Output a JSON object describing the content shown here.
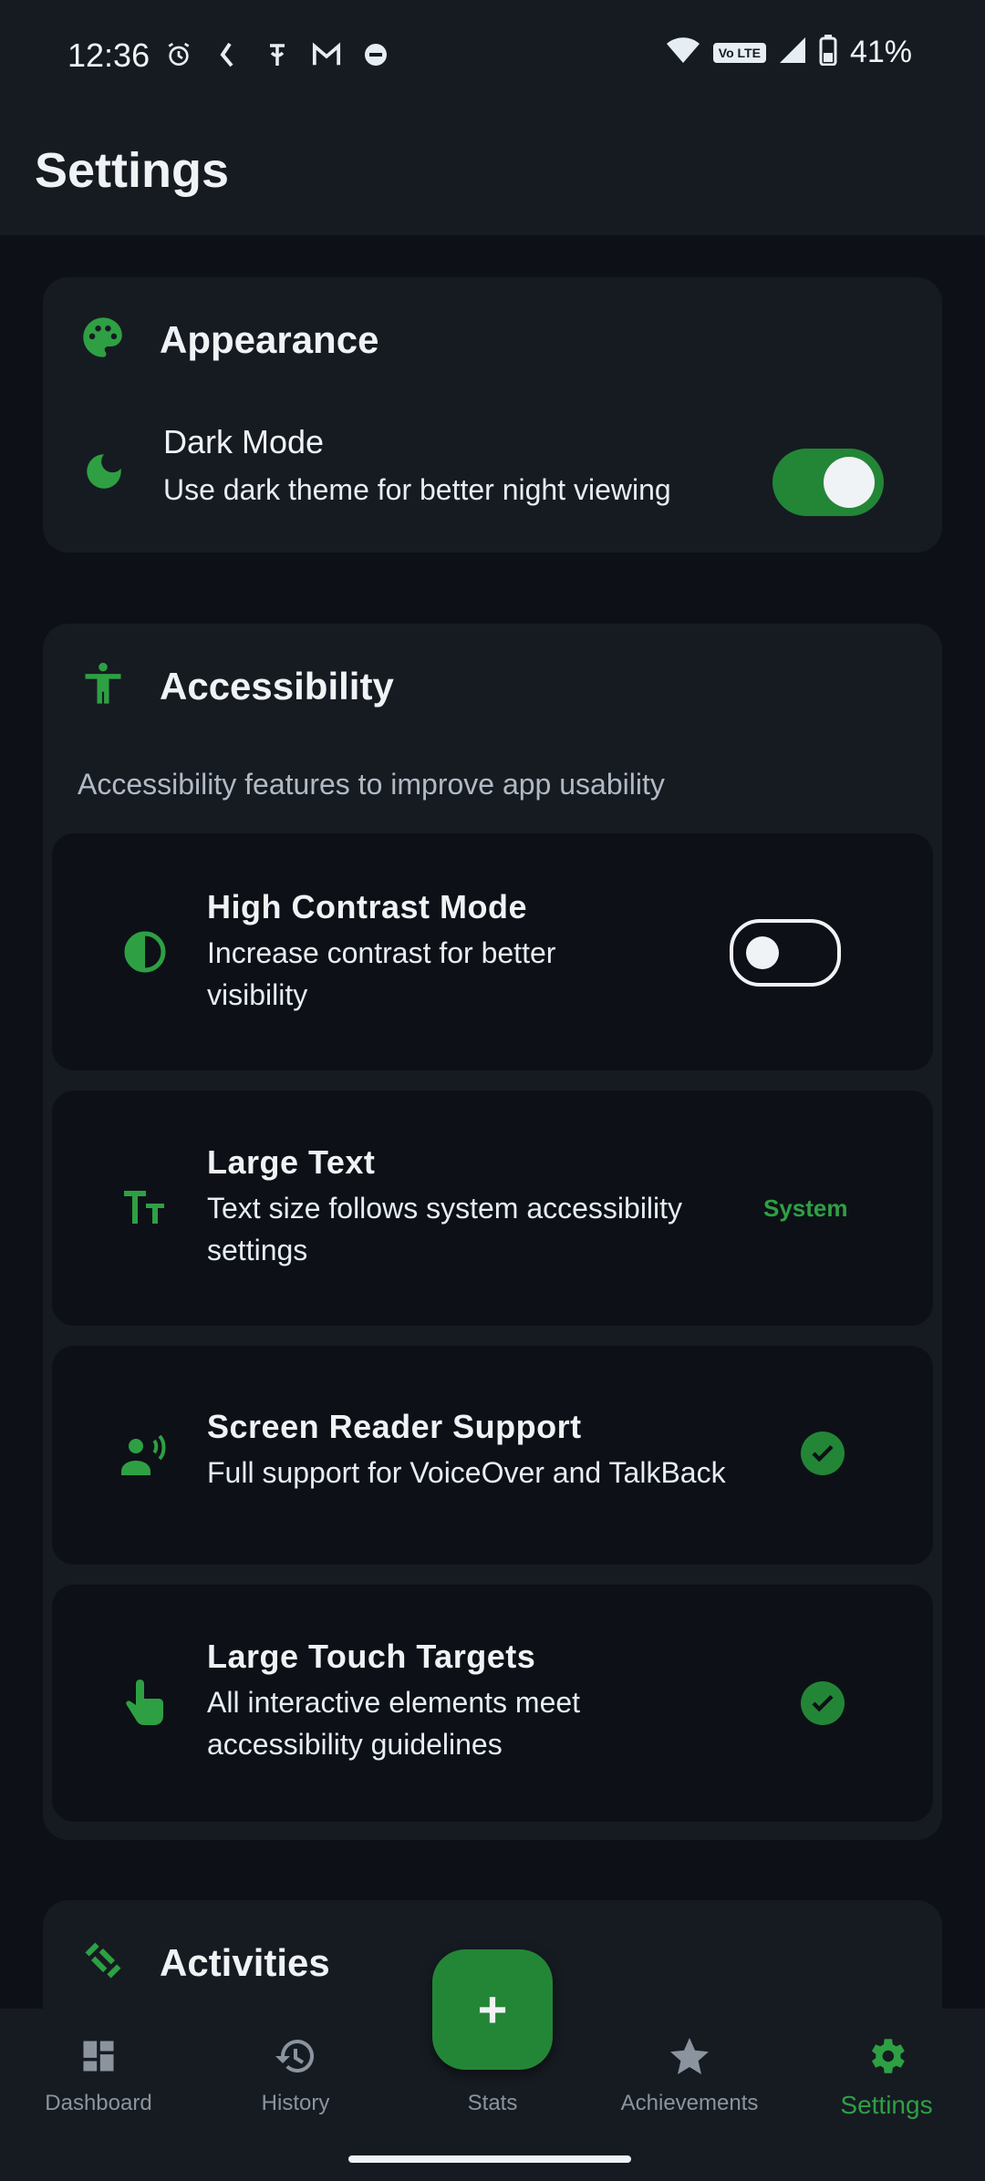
{
  "status_bar": {
    "time": "12:36",
    "battery": "41%",
    "volte": "Vo LTE",
    "left_icons": [
      "alarm-icon",
      "app-notification-icon",
      "app-notification-icon",
      "gmail-icon",
      "app-notification-icon"
    ],
    "right_icons": [
      "wifi-icon",
      "volte-icon",
      "cellular-signal-icon",
      "battery-icon"
    ]
  },
  "header": {
    "title": "Settings"
  },
  "appearance": {
    "title": "Appearance",
    "icon": "palette-icon",
    "dark_mode": {
      "title": "Dark Mode",
      "subtitle": "Use dark theme for better night viewing",
      "enabled": true
    }
  },
  "accessibility": {
    "title": "Accessibility",
    "icon": "accessibility-icon",
    "description": "Accessibility features to improve app usability",
    "items": [
      {
        "title": "High Contrast Mode",
        "subtitle_line1": "Increase contrast for better",
        "subtitle_line2": "visibility",
        "control": "switch",
        "enabled": false
      },
      {
        "title": "Large Text",
        "subtitle_line1": "Text size follows system accessibility",
        "subtitle_line2": "settings",
        "control": "label",
        "value": "System"
      },
      {
        "title": "Screen Reader Support",
        "subtitle_line1": "Full support for VoiceOver and TalkBack",
        "control": "check"
      },
      {
        "title": "Large Touch Targets",
        "subtitle_line1": "All interactive elements meet",
        "subtitle_line2": "accessibility guidelines",
        "control": "check"
      }
    ]
  },
  "activities": {
    "title": "Activities",
    "icon": "fitness-icon"
  },
  "fab": {
    "label": "+"
  },
  "bottom_nav": [
    {
      "label": "Dashboard",
      "icon": "dashboard-icon",
      "active": false
    },
    {
      "label": "History",
      "icon": "history-icon",
      "active": false
    },
    {
      "label": "Stats",
      "icon": "stats-icon",
      "active": false
    },
    {
      "label": "Achievements",
      "icon": "star-icon",
      "active": false
    },
    {
      "label": "Settings",
      "icon": "gear-icon",
      "active": true
    }
  ],
  "colors": {
    "accent": "#238636",
    "accent_text": "#2ea043",
    "background": "#0d1117",
    "surface": "#161b22"
  }
}
